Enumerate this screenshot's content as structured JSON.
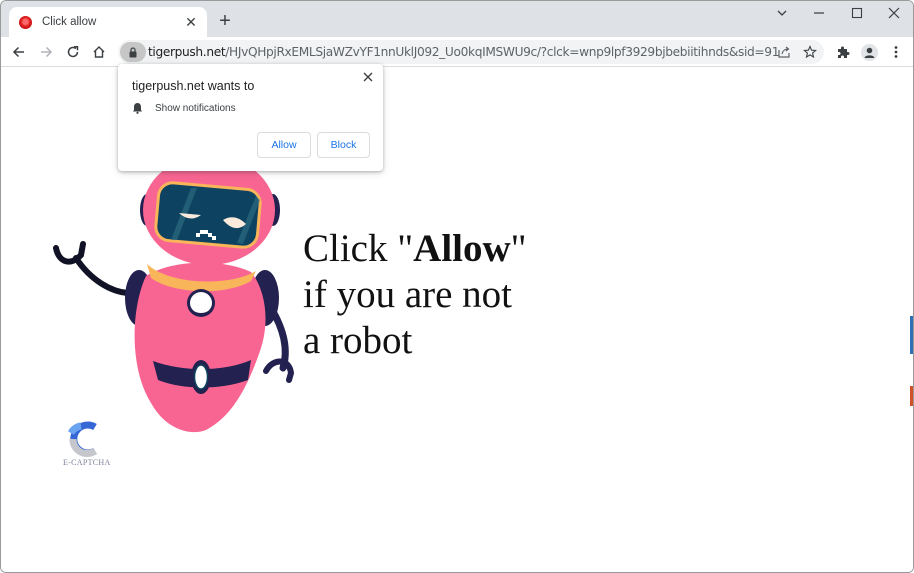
{
  "browser": {
    "tab": {
      "title": "Click allow",
      "favicon": "red-circle-favicon"
    },
    "window_controls": [
      "tab-search-dropdown",
      "minimize",
      "maximize",
      "close"
    ],
    "address_bar": {
      "host": "tigerpush.net",
      "path": "/HJvQHpjRxEMLSjaWZvYF1nnUklJ092_Uo0kqIMSWU9c/?clck=wnp9lpf3929bjbebiitihnds&sid=91",
      "secure_icon": "lock-icon"
    },
    "toolbar_icons": [
      "back-icon",
      "forward-icon",
      "reload-icon",
      "home-icon",
      "share-icon",
      "star-icon",
      "extensions-icon",
      "profile-icon",
      "menu-icon"
    ]
  },
  "permission_prompt": {
    "title": "tigerpush.net wants to",
    "permission": "Show notifications",
    "permission_icon": "bell-icon",
    "allow_label": "Allow",
    "block_label": "Block",
    "close_label": "×"
  },
  "page": {
    "headline_prefix": "Click \"",
    "headline_bold": "Allow",
    "headline_suffix": "\"",
    "headline_line2": "if you are not",
    "headline_line3": "a robot",
    "captcha_brand": "E-CAPTCHA",
    "colors": {
      "robot_pink": "#f96593",
      "robot_navy": "#22214f",
      "robot_collar": "#f9b55a",
      "visor": "#0d4360",
      "link_blue": "#1a73e8"
    }
  }
}
